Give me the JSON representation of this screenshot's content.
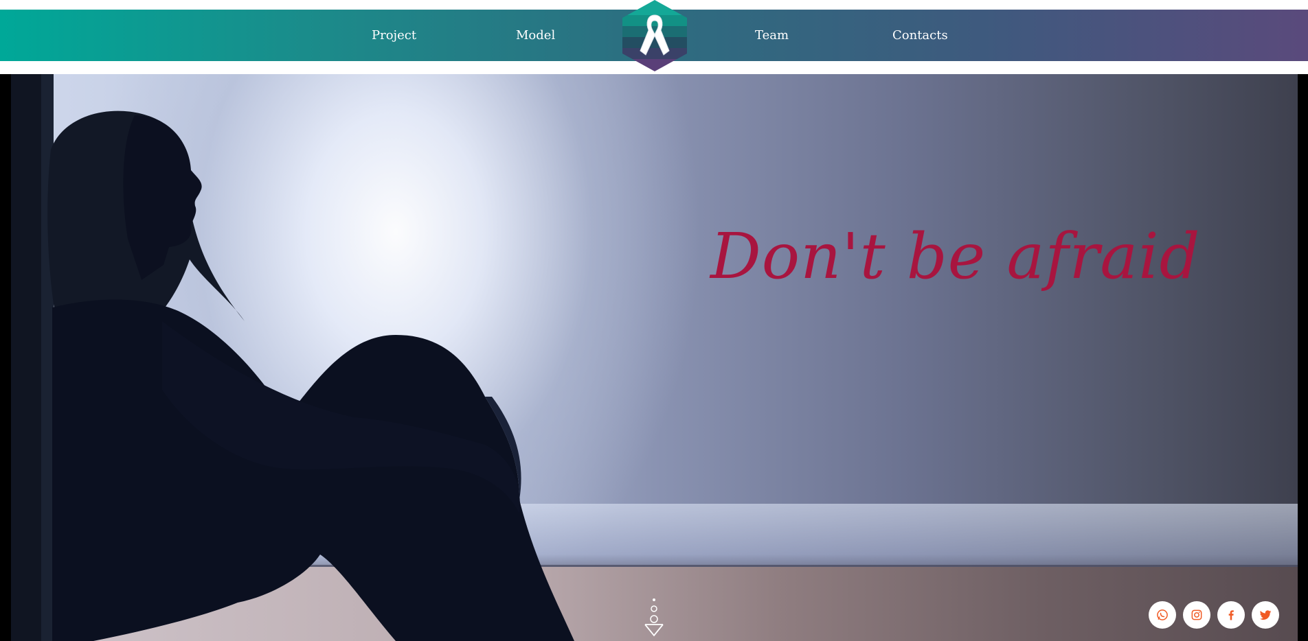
{
  "nav": {
    "items": [
      {
        "label": "Project"
      },
      {
        "label": "Model"
      },
      {
        "label": "Team"
      },
      {
        "label": "Contacts"
      }
    ],
    "logo_icon": "awareness-ribbon-icon"
  },
  "hero": {
    "headline": "Don't be afraid",
    "scroll_icon": "scroll-down-icon"
  },
  "social": {
    "icons": [
      "whatsapp-icon",
      "instagram-icon",
      "facebook-icon",
      "twitter-icon"
    ]
  },
  "colors": {
    "nav_gradient_start": "#00a898",
    "nav_gradient_end": "#5a4a7c",
    "headline": "#a8153f",
    "social_icon": "#f05a24"
  }
}
